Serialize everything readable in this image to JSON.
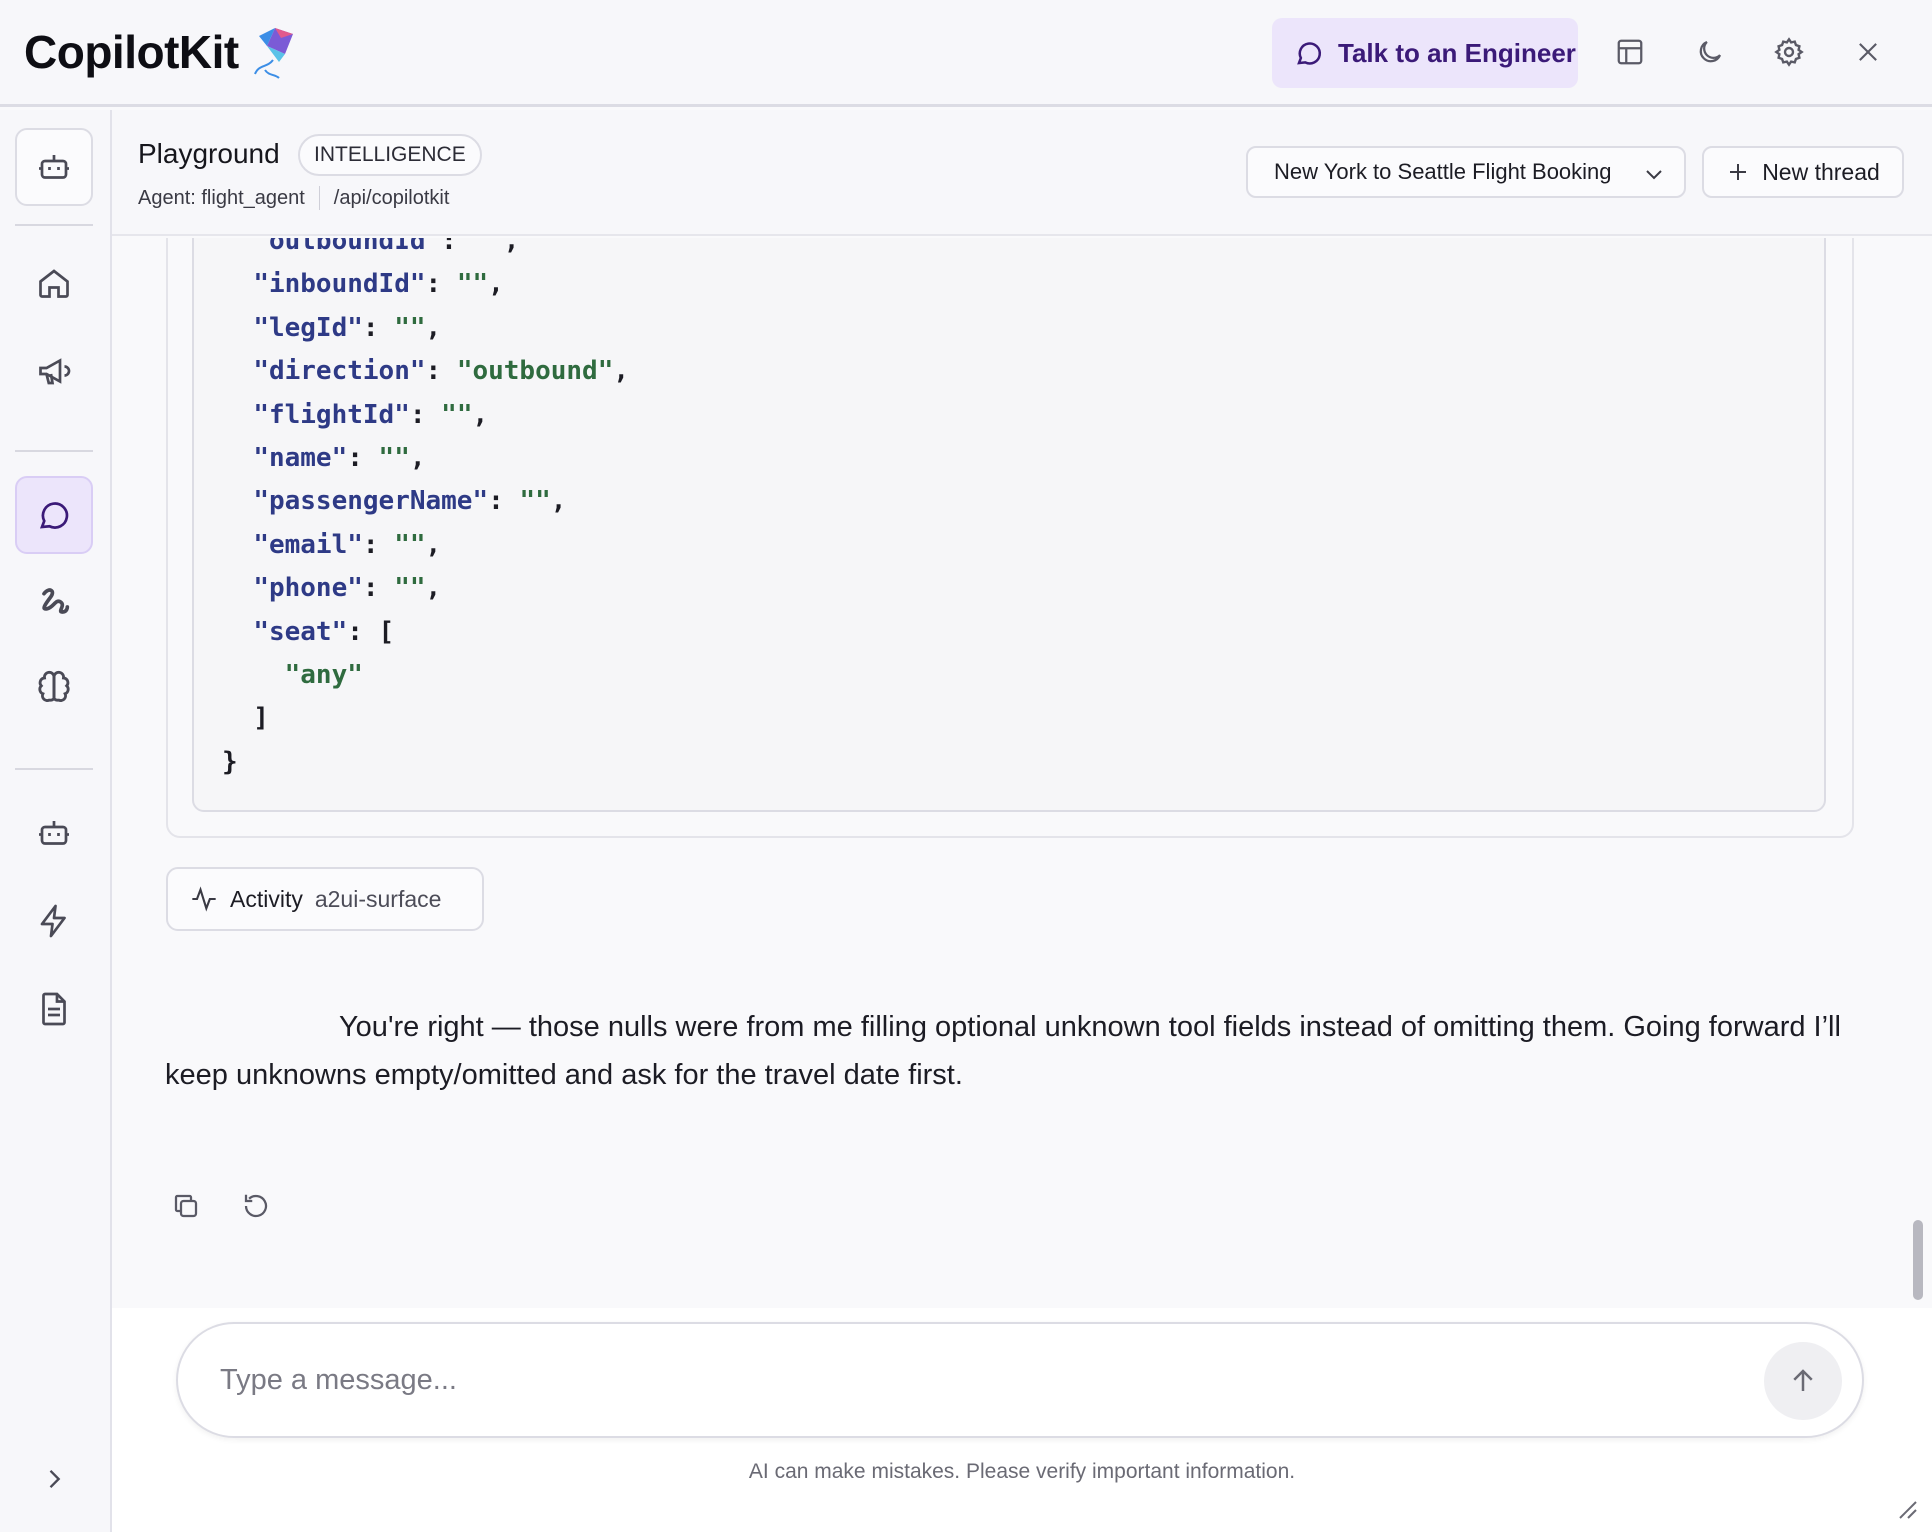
{
  "app": {
    "name": "CopilotKit"
  },
  "topbar": {
    "talk_label": "Talk to an Engineer",
    "icons": [
      "chat-bubble-icon",
      "layout-icon",
      "moon-icon",
      "gear-icon",
      "close-icon"
    ]
  },
  "header": {
    "title": "Playground",
    "badge": "INTELLIGENCE",
    "agent": "Agent: flight_agent",
    "endpoint": "/api/copilotkit",
    "thread_selected": "New York to Seattle Flight Booking",
    "new_thread_label": "New thread"
  },
  "code": {
    "lines": [
      "  \"outboundId\": \"\",",
      "  \"inboundId\": \"\",",
      "  \"legId\": \"\",",
      "  \"direction\": \"outbound\",",
      "  \"flightId\": \"\",",
      "  \"name\": \"\",",
      "  \"passengerName\": \"\",",
      "  \"email\": \"\",",
      "  \"phone\": \"\",",
      "  \"seat\": [",
      "    \"any\"",
      "  ]",
      "}"
    ]
  },
  "activity": {
    "label": "Activity",
    "sub": "a2ui-surface"
  },
  "reply": {
    "text": "You're right — those nulls were from me filling optional unknown tool fields instead of omitting them. Going forward I’ll keep unknowns empty/omitted and ask for the travel date first."
  },
  "composer": {
    "placeholder": "Type a message...",
    "disclaimer": "AI can make mistakes. Please verify important information."
  },
  "colors": {
    "accent_bg": "#ece5fb",
    "accent_text": "#3b1a78",
    "json_key": "#2e3a86",
    "json_string": "#2f6b3f"
  }
}
